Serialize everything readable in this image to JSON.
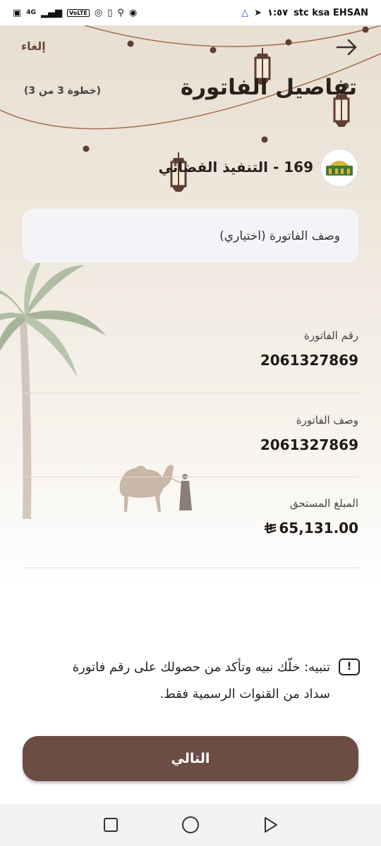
{
  "status_bar": {
    "carrier": "stc ksa EHSAN",
    "time": "١:٥٧",
    "network": "4G",
    "volte": "VoLTE"
  },
  "header": {
    "title": "تفاصيل الفاتورة",
    "step": "(خطوة 3 من 3)",
    "cancel_label": "إلغاء",
    "back_icon": "arrow-right-icon"
  },
  "biller": {
    "name": "169 - التنفيذ القضائي"
  },
  "description_field": {
    "placeholder": "وصف الفاتورة (اختياري)"
  },
  "details": [
    {
      "label": "رقم الفاتورة",
      "value": "2061327869"
    },
    {
      "label": "وصف الفاتورة",
      "value": "2061327869"
    },
    {
      "label": "المبلغ المستحق",
      "value": "65,131.00"
    }
  ],
  "currency_symbol": "riyal-symbol-icon",
  "notice": {
    "text": "تنبيه: خلّك نبيه وتأكد من حصولك على رقم فاتورة سداد من القنوات الرسمية فقط."
  },
  "next_button": {
    "label": "التالي"
  },
  "colors": {
    "brand_brown": "#6b4d44",
    "header_beige": "#e8dfd2",
    "text_dark": "#2a211c"
  }
}
